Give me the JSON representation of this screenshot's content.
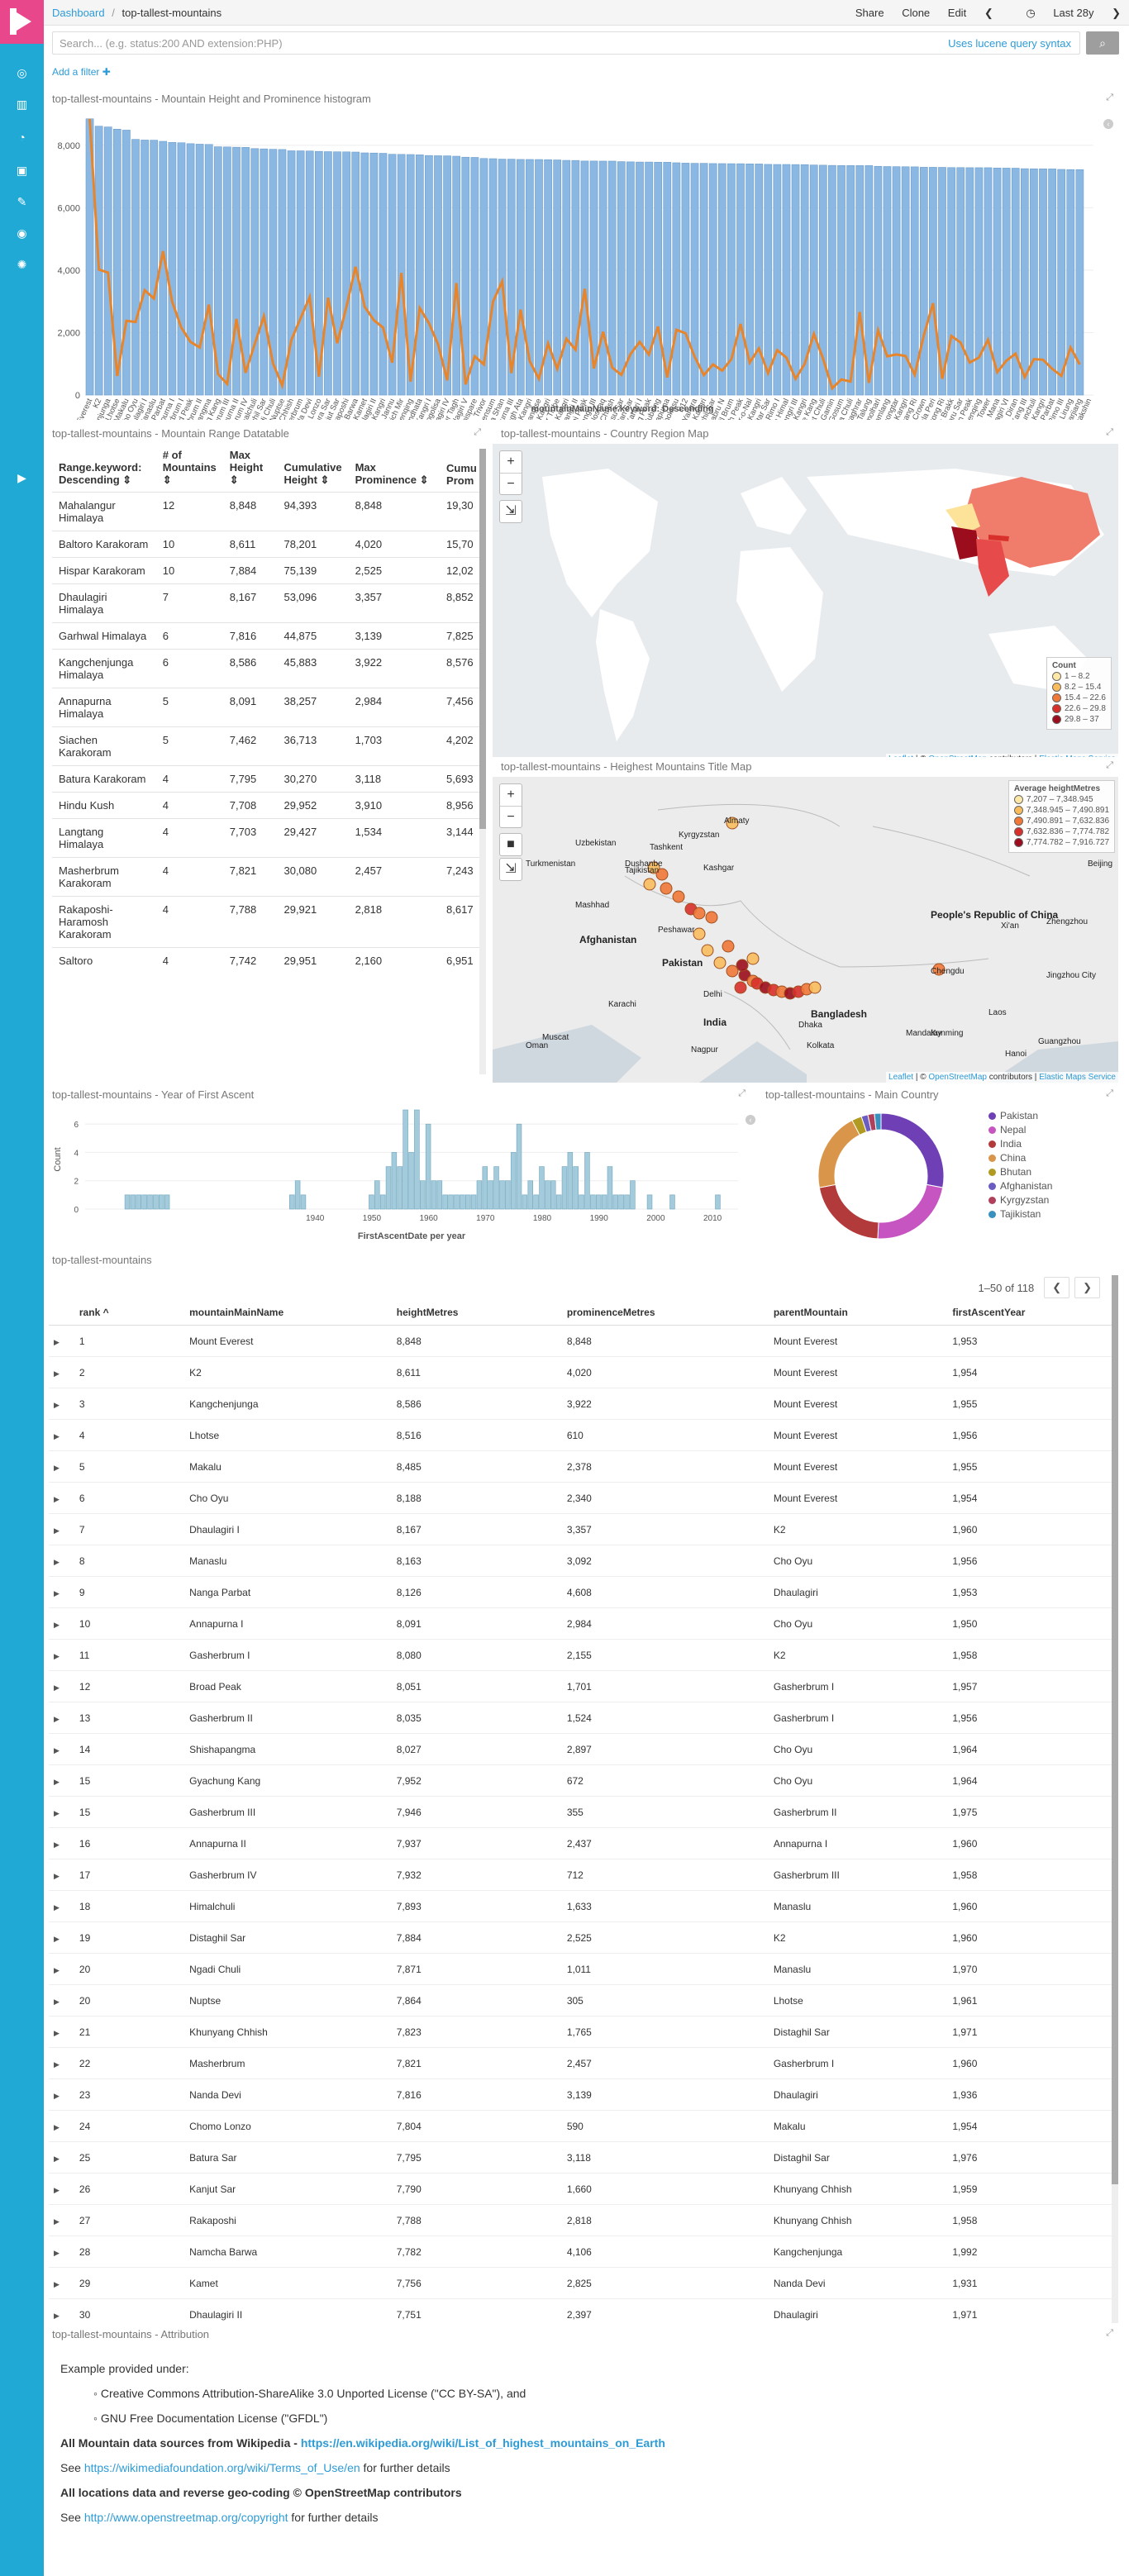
{
  "header": {
    "breadcrumb_root": "Dashboard",
    "breadcrumb_sep": "/",
    "dashboard_title": "top-tallest-mountains",
    "menu": {
      "share": "Share",
      "clone": "Clone",
      "edit": "Edit",
      "prev": "❮",
      "time": "Last 28y",
      "next": "❯"
    }
  },
  "search": {
    "placeholder": "Search... (e.g. status:200 AND extension:PHP)",
    "lucene_link": "Uses lucene query syntax",
    "add_filter": "Add a filter ✚"
  },
  "histogram": {
    "title": "top-tallest-mountains - Mountain Height and Prominence histogram",
    "x_axis_title": "mountainMainName.keyword: Descending",
    "colors": {
      "bars": "#8bb8e3",
      "line": "#e8842a"
    },
    "y_ticks": [
      "0",
      "2,000",
      "4,000",
      "6,000",
      "8,000"
    ],
    "y_max": 9000
  },
  "chart_data": [
    {
      "type": "bar",
      "title": "top-tallest-mountains - Mountain Height and Prominence histogram",
      "xlabel": "mountainMainName.keyword: Descending",
      "ylim": [
        0,
        9000
      ],
      "categories": [
        "Mount Everest",
        "K2",
        "Kangchenjunga",
        "Lhotse",
        "Makalu",
        "Cho Oyu",
        "Dhaulagiri I",
        "Manaslu",
        "Nanga Parbat",
        "Annapurna I",
        "Gasherbrum I",
        "Broad Peak",
        "Gasherbrum II",
        "Shishapangma",
        "Gyachung Kang",
        "Gasherbrum III",
        "Annapurna II",
        "Gasherbrum IV",
        "Himalchuli",
        "Distaghil Sar",
        "Ngadi Chuli",
        "Nuptse",
        "Khunyang Chhish",
        "Masherbrum",
        "Nanda Devi",
        "Chomo Lonzo",
        "Batura Sar",
        "Kanjut Sar",
        "Rakaposhi",
        "Namcha Barwa",
        "Kamet",
        "Dhaulagiri II",
        "Saltoro Kangri",
        "Jannu",
        "Tirich Mir",
        "Molamenqing",
        "Gurla Mandhata",
        "Saser Kangri I",
        "Chogolisa",
        "Dhaulagiri IV",
        "Kongur Tagh",
        "Dhaulagiri V",
        "Shispare",
        "Trivor",
        "Gangkhar Puensum",
        "Gongga Shan",
        "Annapurna III",
        "Muztagh Ata",
        "Skyang Kangri",
        "Changtse",
        "Kula Kangri",
        "Kongur Tiube",
        "Mamostong Kangri",
        "Saser Kangri II",
        "Ismoil Somoni Peak",
        "Saser Kangri III",
        "Noshaq",
        "Pumari Chhish",
        "Passu Sar",
        "Yukshin Gardan Sar",
        "Teram Kangri I",
        "Jongsong Peak",
        "Malubiting",
        "Gangapurna",
        "Jengish Chokusu",
        "K12",
        "Yangra",
        "Sia Kangri",
        "Momhil Sar",
        "Kabru N",
        "Skil Brum",
        "Haramosh Peak",
        "Istor-o-Nal",
        "Ghent Kangri",
        "Ultar Sar",
        "Rimo I",
        "Churen Himal",
        "Teram Kangri III",
        "Sherpi Kangri",
        "Labuche Kang",
        "Kirat Chuli",
        "Abi Gamin",
        "Nangpai Gosum",
        "Gimmigela Chuli",
        "Saraghrar",
        "Talung",
        "Jomolhari",
        "Chamlang",
        "Chongtar",
        "Baltoro Kangri",
        "Siguang Ri",
        "The Crown",
        "Gyala Peri",
        "Porong Ri",
        "Baintha Brakk",
        "Yutmaru Sar",
        "Baltistan Peak",
        "Kangpenqing",
        "Muztagh Tower",
        "Mana",
        "Dhaulagiri VI",
        "Diran",
        "Labuche Kang III",
        "Putha Hiunchuli",
        "Apsarasas Kangri",
        "Mukut Parbat",
        "Rimo III",
        "Langtang Lirung",
        "Karjiang",
        "Annapurna Dakshin"
      ],
      "series": [
        {
          "name": "heightMetres",
          "values": [
            8848,
            8611,
            8586,
            8516,
            8485,
            8188,
            8167,
            8163,
            8126,
            8091,
            8080,
            8051,
            8035,
            8027,
            7952,
            7946,
            7937,
            7932,
            7893,
            7884,
            7871,
            7864,
            7823,
            7821,
            7816,
            7804,
            7795,
            7790,
            7788,
            7782,
            7756,
            7751,
            7742,
            7711,
            7708,
            7703,
            7694,
            7672,
            7665,
            7661,
            7649,
            7618,
            7611,
            7577,
            7570,
            7556,
            7555,
            7546,
            7545,
            7543,
            7538,
            7530,
            7516,
            7513,
            7495,
            7495,
            7492,
            7492,
            7476,
            7469,
            7462,
            7462,
            7458,
            7455,
            7439,
            7428,
            7422,
            7422,
            7414,
            7412,
            7410,
            7409,
            7403,
            7401,
            7388,
            7385,
            7385,
            7382,
            7380,
            7367,
            7362,
            7355,
            7350,
            7350,
            7349,
            7349,
            7326,
            7319,
            7315,
            7312,
            7309,
            7295,
            7294,
            7292,
            7285,
            7285,
            7282,
            7281,
            7281,
            7272,
            7268,
            7266,
            7250,
            7246,
            7245,
            7242,
            7227,
            7221,
            7219
          ]
        },
        {
          "name": "prominenceMetres",
          "values": [
            8848,
            4020,
            3922,
            610,
            2378,
            2340,
            3357,
            3092,
            4608,
            2984,
            2155,
            1701,
            1524,
            2897,
            672,
            355,
            2437,
            712,
            1633,
            2525,
            1011,
            305,
            1765,
            2457,
            3139,
            590,
            3118,
            1660,
            2818,
            4106,
            2825,
            2397,
            2160,
            1036,
            3910,
            430,
            2788,
            2304,
            1624,
            469,
            3585,
            340,
            1240,
            980,
            2995,
            3642,
            703,
            2735,
            1085,
            520,
            1650,
            840,
            1803,
            1450,
            3402,
            850,
            2024,
            880,
            645,
            1313,
            1702,
            1298,
            2193,
            563,
            2089,
            1978,
            1219,
            640,
            980,
            780,
            1150,
            2277,
            1040,
            1493,
            700,
            1438,
            1200,
            520,
            1000,
            1957,
            1168,
            217,
            500,
            432,
            2661,
            390,
            2077,
            1241,
            1300,
            1251,
            650,
            1919,
            2942,
            520,
            1891,
            1681,
            1040,
            1200,
            1771,
            730,
            1100,
            1325,
            570,
            1151,
            1130,
            840,
            615,
            1525,
            980
          ]
        }
      ]
    },
    {
      "type": "bar",
      "title": "top-tallest-mountains - Year of First Ascent",
      "xlabel": "FirstAscentDate per year",
      "ylabel": "Count",
      "ylim": [
        0,
        7
      ],
      "x": [
        1907,
        1908,
        1909,
        1910,
        1911,
        1912,
        1913,
        1914,
        1936,
        1937,
        1938,
        1950,
        1951,
        1952,
        1953,
        1954,
        1955,
        1956,
        1957,
        1958,
        1959,
        1960,
        1961,
        1962,
        1963,
        1964,
        1965,
        1966,
        1967,
        1968,
        1969,
        1970,
        1971,
        1972,
        1973,
        1974,
        1975,
        1976,
        1977,
        1978,
        1979,
        1980,
        1981,
        1982,
        1983,
        1984,
        1985,
        1986,
        1987,
        1988,
        1989,
        1990,
        1991,
        1992,
        1993,
        1994,
        1995,
        1996,
        1999,
        2003,
        2011
      ],
      "values": [
        1,
        1,
        1,
        1,
        1,
        1,
        1,
        1,
        1,
        2,
        1,
        1,
        2,
        1,
        3,
        4,
        3,
        7,
        4,
        7,
        2,
        6,
        2,
        2,
        1,
        1,
        1,
        1,
        1,
        1,
        2,
        3,
        2,
        3,
        2,
        2,
        4,
        6,
        1,
        2,
        1,
        3,
        2,
        2,
        1,
        3,
        4,
        3,
        1,
        4,
        1,
        1,
        1,
        3,
        1,
        1,
        1,
        2,
        1,
        1,
        1
      ]
    },
    {
      "type": "pie",
      "title": "top-tallest-mountains - Main Country",
      "categories": [
        "Pakistan",
        "Nepal",
        "India",
        "China",
        "Bhutan",
        "Afghanistan",
        "Kyrgyzstan",
        "Tajikistan"
      ],
      "values": [
        33,
        27,
        25,
        24,
        3,
        2,
        2,
        2
      ],
      "colors": [
        "#6f3fb5",
        "#c655c2",
        "#b33a3a",
        "#d9954a",
        "#b09a22",
        "#6a5cc0",
        "#b0405c",
        "#3a91c0"
      ]
    }
  ],
  "range_table": {
    "title": "top-tallest-mountains - Mountain Range Datatable",
    "headers": [
      "Range.keyword: Descending ⇕",
      "# of Mountains ⇕",
      "Max Height ⇕",
      "Cumulative Height ⇕",
      "Max Prominence ⇕",
      "Cumu Prom"
    ],
    "rows": [
      [
        "Mahalangur Himalaya",
        "12",
        "8,848",
        "94,393",
        "8,848",
        "19,30"
      ],
      [
        "Baltoro Karakoram",
        "10",
        "8,611",
        "78,201",
        "4,020",
        "15,70"
      ],
      [
        "Hispar Karakoram",
        "10",
        "7,884",
        "75,139",
        "2,525",
        "12,02"
      ],
      [
        "Dhaulagiri Himalaya",
        "7",
        "8,167",
        "53,096",
        "3,357",
        "8,852"
      ],
      [
        "Garhwal Himalaya",
        "6",
        "7,816",
        "44,875",
        "3,139",
        "7,825"
      ],
      [
        "Kangchenjunga Himalaya",
        "6",
        "8,586",
        "45,883",
        "3,922",
        "8,576"
      ],
      [
        "Annapurna Himalaya",
        "5",
        "8,091",
        "38,257",
        "2,984",
        "7,456"
      ],
      [
        "Siachen Karakoram",
        "5",
        "7,462",
        "36,713",
        "1,703",
        "4,202"
      ],
      [
        "Batura Karakoram",
        "4",
        "7,795",
        "30,270",
        "3,118",
        "5,693"
      ],
      [
        "Hindu Kush",
        "4",
        "7,708",
        "29,952",
        "3,910",
        "8,956"
      ],
      [
        "Langtang Himalaya",
        "4",
        "7,703",
        "29,427",
        "1,534",
        "3,144"
      ],
      [
        "Masherbrum Karakoram",
        "4",
        "7,821",
        "30,080",
        "2,457",
        "7,243"
      ],
      [
        "Rakaposhi-Haramosh Karakoram",
        "4",
        "7,788",
        "29,921",
        "2,818",
        "8,617"
      ],
      [
        "Saltoro",
        "4",
        "7,742",
        "29,951",
        "2,160",
        "6,951"
      ]
    ]
  },
  "country_map": {
    "title": "top-tallest-mountains - Country Region Map",
    "legend_title": "Count",
    "legend": [
      {
        "label": "1 – 8.2",
        "color": "#fee8a8"
      },
      {
        "label": "8.2 – 15.4",
        "color": "#f9bc5d"
      },
      {
        "label": "15.4 – 22.6",
        "color": "#f07838"
      },
      {
        "label": "22.6 – 29.8",
        "color": "#d8302a"
      },
      {
        "label": "29.8 – 37",
        "color": "#9b0d1c"
      }
    ],
    "attribution": {
      "leaflet": "Leaflet",
      "sep": " | © ",
      "osm": "OpenStreetMap",
      "contrib": " contributors | ",
      "ems": "Elastic Maps Service"
    }
  },
  "title_map": {
    "title": "top-tallest-mountains - Heighest Mountains Title Map",
    "legend_title": "Average heightMetres",
    "legend": [
      {
        "label": "7,207 – 7,348.945",
        "color": "#fee8a8"
      },
      {
        "label": "7,348.945 – 7,490.891",
        "color": "#f9bc5d"
      },
      {
        "label": "7,490.891 – 7,632.836",
        "color": "#f07838"
      },
      {
        "label": "7,632.836 – 7,774.782",
        "color": "#d8302a"
      },
      {
        "label": "7,774.782 – 7,916.727",
        "color": "#9b0d1c"
      }
    ],
    "labels": [
      "Almaty",
      "Uzbekistan",
      "Tashkent",
      "Kyrgyzstan",
      "Dushanbe",
      "Tajikistan",
      "Kashgar",
      "Turkmenistan",
      "Mashhad",
      "Afghanistan",
      "Peshawar",
      "Pakistan",
      "Delhi",
      "Karachi",
      "India",
      "Muscat",
      "Oman",
      "Nagpur",
      "Kolkata",
      "Bangladesh",
      "Dhaka",
      "People's Republic of China",
      "Chengdu",
      "Xi'an",
      "Zhengzhou",
      "Beijing",
      "Jingzhou City",
      "Kunming",
      "Guangzhou",
      "Hanoi",
      "Laos",
      "Mandalay"
    ],
    "attribution": {
      "leaflet": "Leaflet",
      "sep": " | © ",
      "osm": "OpenStreetMap",
      "contrib": " contributors | ",
      "ems": "Elastic Maps Service"
    }
  },
  "ascent": {
    "title": "top-tallest-mountains - Year of First Ascent",
    "ylabel": "Count",
    "xlabel": "FirstAscentDate per year",
    "x_ticks": [
      "1940",
      "1950",
      "1960",
      "1970",
      "1980",
      "1990",
      "2000",
      "2010"
    ],
    "y_ticks": [
      "0",
      "2",
      "4",
      "6"
    ],
    "bar_color": "#a3cbdb"
  },
  "country_pie": {
    "title": "top-tallest-mountains - Main Country"
  },
  "mountains_table": {
    "title": "top-tallest-mountains",
    "pagination": "1–50 of 118",
    "prev": "❮",
    "next": "❯",
    "headers": [
      "rank ^",
      "mountainMainName",
      "heightMetres",
      "prominenceMetres",
      "parentMountain",
      "firstAscentYear"
    ],
    "rows": [
      [
        "1",
        "Mount Everest",
        "8,848",
        "8,848",
        "Mount Everest",
        "1,953"
      ],
      [
        "2",
        "K2",
        "8,611",
        "4,020",
        "Mount Everest",
        "1,954"
      ],
      [
        "3",
        "Kangchenjunga",
        "8,586",
        "3,922",
        "Mount Everest",
        "1,955"
      ],
      [
        "4",
        "Lhotse",
        "8,516",
        "610",
        "Mount Everest",
        "1,956"
      ],
      [
        "5",
        "Makalu",
        "8,485",
        "2,378",
        "Mount Everest",
        "1,955"
      ],
      [
        "6",
        "Cho Oyu",
        "8,188",
        "2,340",
        "Mount Everest",
        "1,954"
      ],
      [
        "7",
        "Dhaulagiri I",
        "8,167",
        "3,357",
        "K2",
        "1,960"
      ],
      [
        "8",
        "Manaslu",
        "8,163",
        "3,092",
        "Cho Oyu",
        "1,956"
      ],
      [
        "9",
        "Nanga Parbat",
        "8,126",
        "4,608",
        "Dhaulagiri",
        "1,953"
      ],
      [
        "10",
        "Annapurna I",
        "8,091",
        "2,984",
        "Cho Oyu",
        "1,950"
      ],
      [
        "11",
        "Gasherbrum I",
        "8,080",
        "2,155",
        "K2",
        "1,958"
      ],
      [
        "12",
        "Broad Peak",
        "8,051",
        "1,701",
        "Gasherbrum I",
        "1,957"
      ],
      [
        "13",
        "Gasherbrum II",
        "8,035",
        "1,524",
        "Gasherbrum I",
        "1,956"
      ],
      [
        "14",
        "Shishapangma",
        "8,027",
        "2,897",
        "Cho Oyu",
        "1,964"
      ],
      [
        "15",
        "Gyachung Kang",
        "7,952",
        "672",
        "Cho Oyu",
        "1,964"
      ],
      [
        "15",
        "Gasherbrum III",
        "7,946",
        "355",
        "Gasherbrum II",
        "1,975"
      ],
      [
        "16",
        "Annapurna II",
        "7,937",
        "2,437",
        "Annapurna I",
        "1,960"
      ],
      [
        "17",
        "Gasherbrum IV",
        "7,932",
        "712",
        "Gasherbrum III",
        "1,958"
      ],
      [
        "18",
        "Himalchuli",
        "7,893",
        "1,633",
        "Manaslu",
        "1,960"
      ],
      [
        "19",
        "Distaghil Sar",
        "7,884",
        "2,525",
        "K2",
        "1,960"
      ],
      [
        "20",
        "Ngadi Chuli",
        "7,871",
        "1,011",
        "Manaslu",
        "1,970"
      ],
      [
        "20",
        "Nuptse",
        "7,864",
        "305",
        "Lhotse",
        "1,961"
      ],
      [
        "21",
        "Khunyang Chhish",
        "7,823",
        "1,765",
        "Distaghil Sar",
        "1,971"
      ],
      [
        "22",
        "Masherbrum",
        "7,821",
        "2,457",
        "Gasherbrum I",
        "1,960"
      ],
      [
        "23",
        "Nanda Devi",
        "7,816",
        "3,139",
        "Dhaulagiri",
        "1,936"
      ],
      [
        "24",
        "Chomo Lonzo",
        "7,804",
        "590",
        "Makalu",
        "1,954"
      ],
      [
        "25",
        "Batura Sar",
        "7,795",
        "3,118",
        "Distaghil Sar",
        "1,976"
      ],
      [
        "26",
        "Kanjut Sar",
        "7,790",
        "1,660",
        "Khunyang Chhish",
        "1,959"
      ],
      [
        "27",
        "Rakaposhi",
        "7,788",
        "2,818",
        "Khunyang Chhish",
        "1,958"
      ],
      [
        "28",
        "Namcha Barwa",
        "7,782",
        "4,106",
        "Kangchenjunga",
        "1,992"
      ],
      [
        "29",
        "Kamet",
        "7,756",
        "2,825",
        "Nanda Devi",
        "1,931"
      ],
      [
        "30",
        "Dhaulagiri II",
        "7,751",
        "2,397",
        "Dhaulagiri",
        "1,971"
      ]
    ]
  },
  "attribution_panel": {
    "title": "top-tallest-mountains - Attribution",
    "intro": "Example provided under:",
    "li1": "Creative Commons Attribution-ShareAlike 3.0 Unported License (\"CC BY-SA\"), and",
    "li2": "GNU Free Documentation License (\"GFDL\")",
    "wiki_bold": "All Mountain data sources from Wikipedia - ",
    "wiki_link": "https://en.wikipedia.org/wiki/List_of_highest_mountains_on_Earth",
    "see1": "See ",
    "wm_link": "https://wikimediafoundation.org/wiki/Terms_of_Use/en",
    "further1": " for further details",
    "osm_bold": "All locations data and reverse geo-coding © OpenStreetMap contributors",
    "see2": "See ",
    "osm_link": "http://www.openstreetmap.org/copyright",
    "further2": " for further details"
  }
}
